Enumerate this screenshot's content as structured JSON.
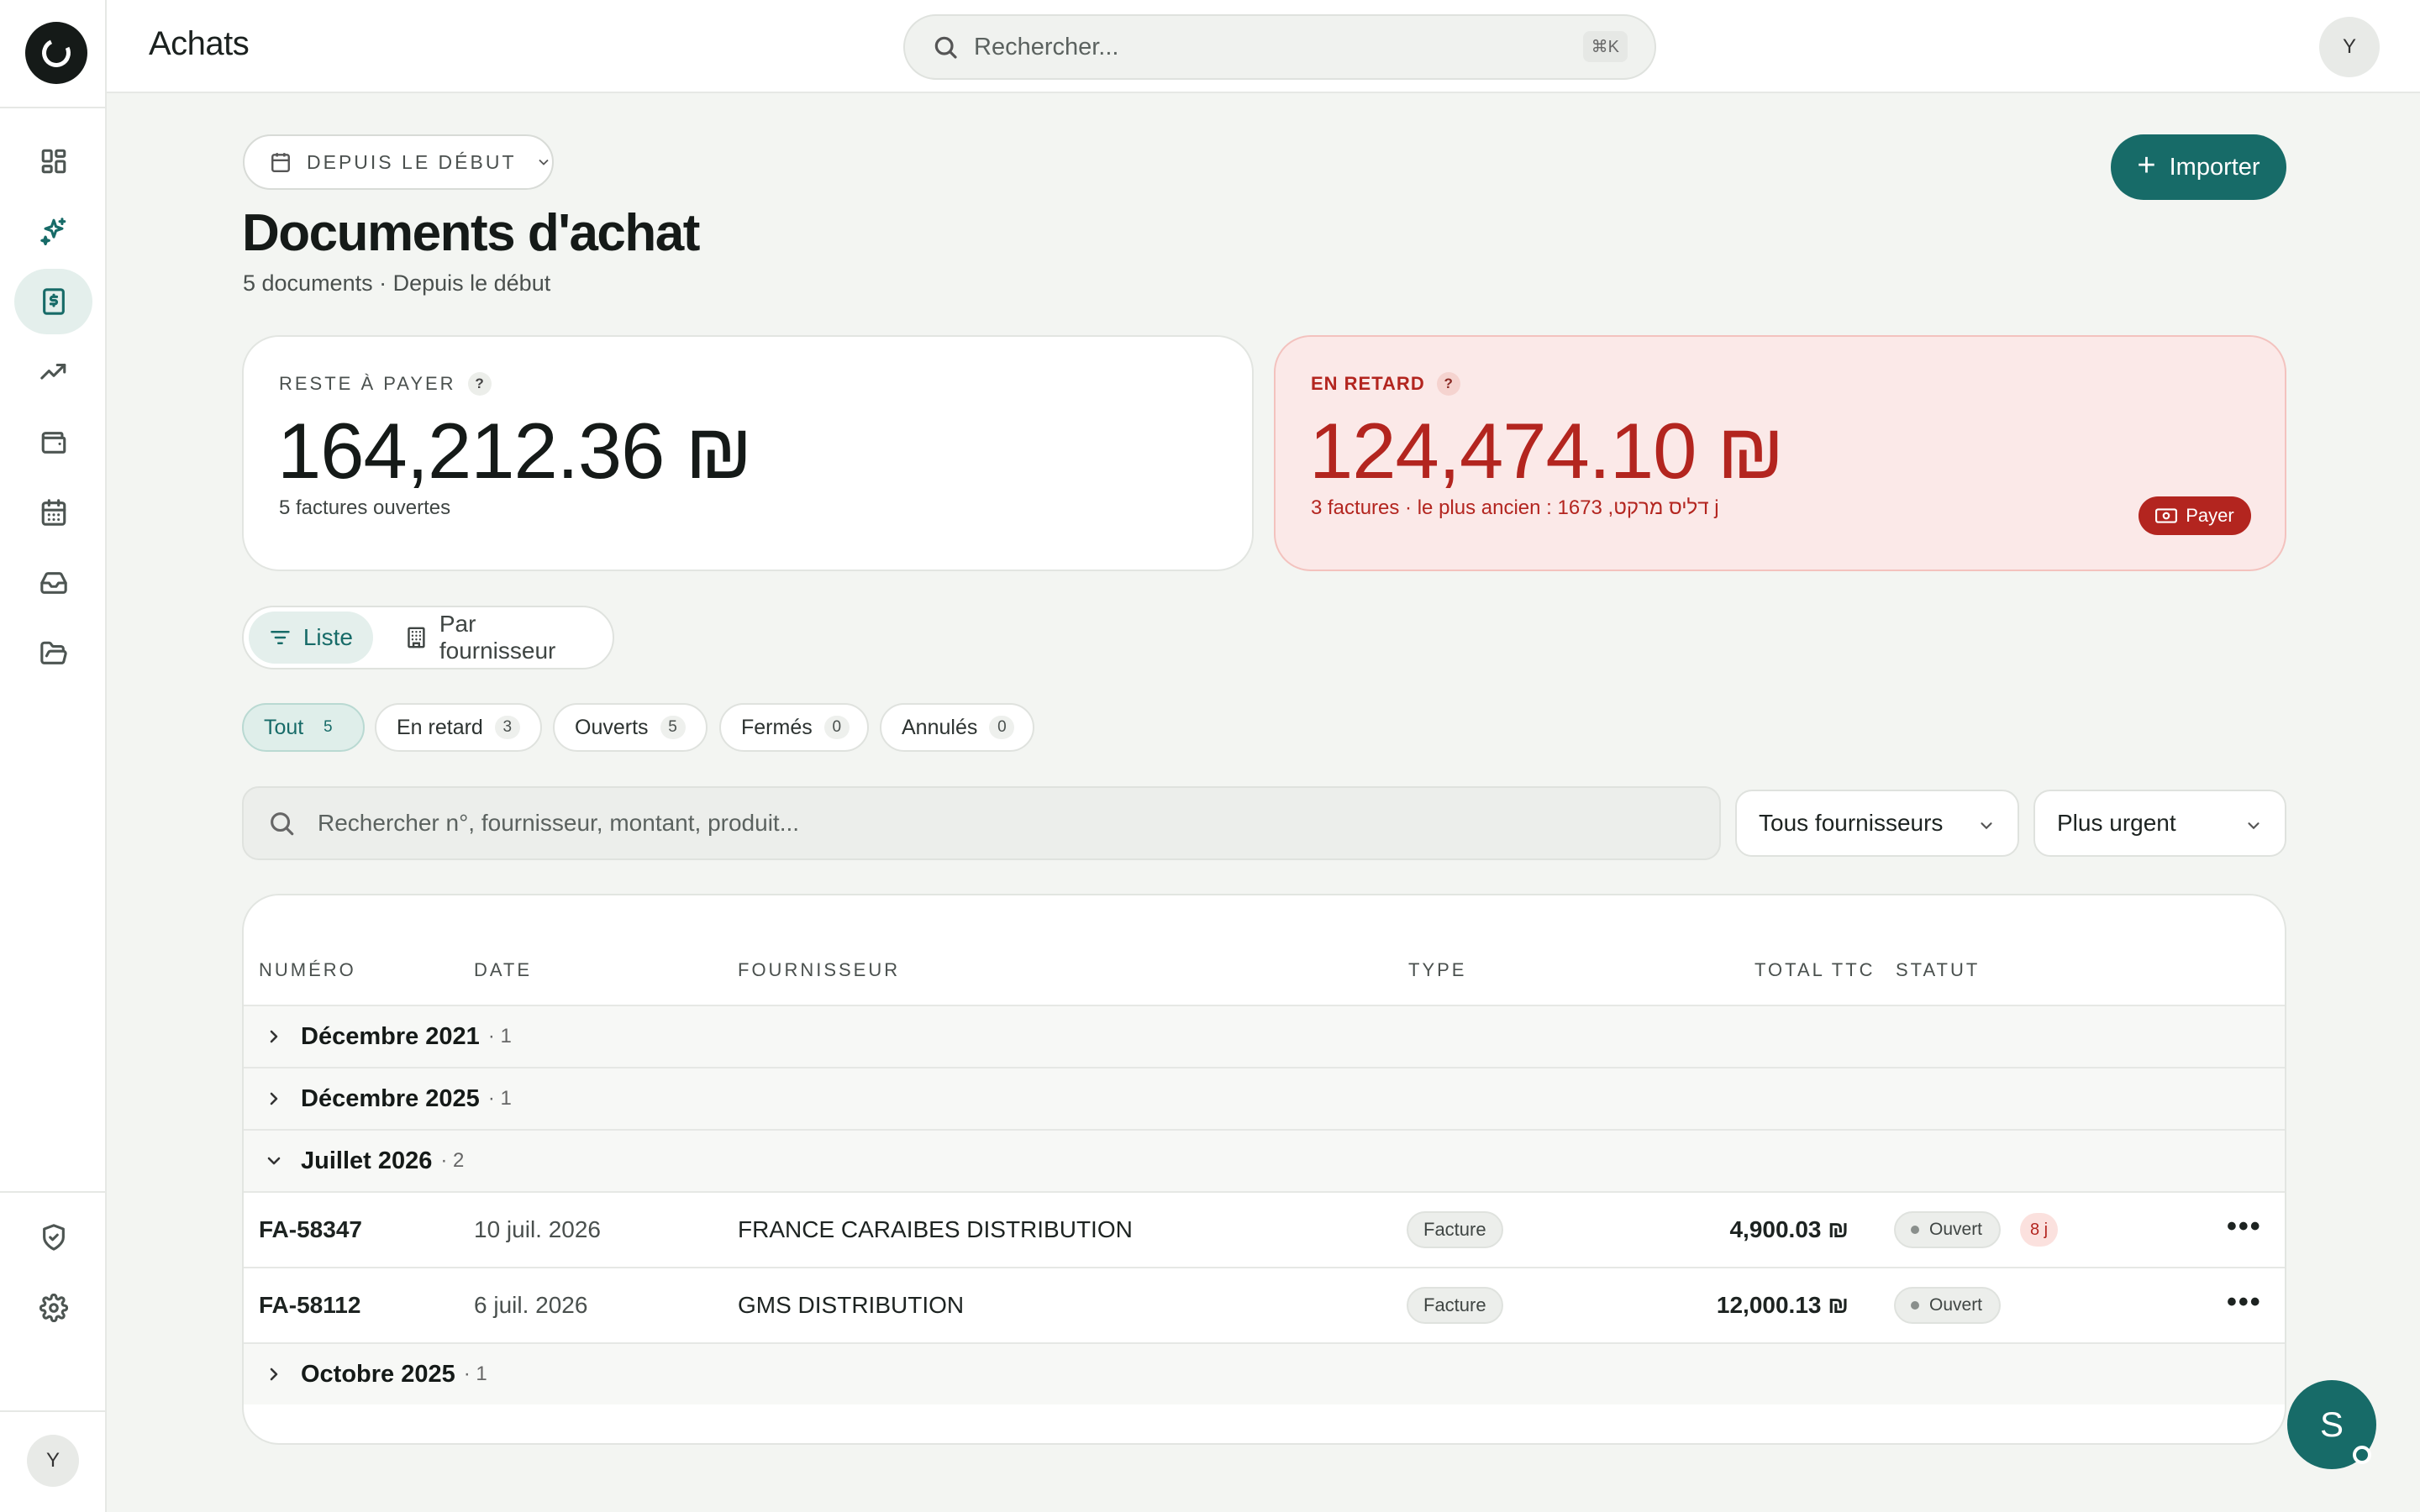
{
  "app": {
    "title": "Achats",
    "avatar_initial": "Y",
    "side_avatar_initial": "Y"
  },
  "search": {
    "placeholder": "Rechercher...",
    "shortcut": "⌘K"
  },
  "sidebar": {
    "items": [
      {
        "name": "dashboard",
        "icon": "grid-icon"
      },
      {
        "name": "ai",
        "icon": "sparkles-icon"
      },
      {
        "name": "purchases",
        "icon": "receipt-icon",
        "active": true
      },
      {
        "name": "trends",
        "icon": "trending-up-icon"
      },
      {
        "name": "wallet",
        "icon": "wallet-icon"
      },
      {
        "name": "calendar",
        "icon": "calendar-icon"
      },
      {
        "name": "inbox",
        "icon": "inbox-icon"
      },
      {
        "name": "folder",
        "icon": "folder-icon"
      }
    ],
    "bottom_items": [
      {
        "name": "security",
        "icon": "shield-check-icon"
      },
      {
        "name": "settings",
        "icon": "gear-icon"
      }
    ]
  },
  "period_filter": {
    "label": "DEPUIS LE DÉBUT"
  },
  "import_button": {
    "label": "Importer"
  },
  "page": {
    "title": "Documents d'achat",
    "subtitle": "5 documents · Depuis le début"
  },
  "cards": {
    "remaining": {
      "label": "RESTE À PAYER",
      "amount": "164,212.36 ₪",
      "sub": "5 factures ouvertes"
    },
    "overdue": {
      "label": "EN RETARD",
      "amount": "124,474.10 ₪",
      "sub": "3 factures · le plus ancien : דליס מרקט, 1673 j",
      "pay_label": "Payer"
    }
  },
  "view_toggle": {
    "list": "Liste",
    "by_supplier": "Par fournisseur"
  },
  "filters": [
    {
      "label": "Tout",
      "count": "5",
      "active": true
    },
    {
      "label": "En retard",
      "count": "3"
    },
    {
      "label": "Ouverts",
      "count": "5"
    },
    {
      "label": "Fermés",
      "count": "0"
    },
    {
      "label": "Annulés",
      "count": "0"
    }
  ],
  "table_search": {
    "placeholder": "Rechercher n°, fournisseur, montant, produit..."
  },
  "supplier_select": {
    "value": "Tous fournisseurs"
  },
  "sort_select": {
    "value": "Plus urgent"
  },
  "table": {
    "headers": {
      "number": "NUMÉRO",
      "date": "DATE",
      "supplier": "FOURNISSEUR",
      "type": "TYPE",
      "total": "TOTAL TTC",
      "status": "STATUT"
    },
    "groups": [
      {
        "label": "Décembre 2021",
        "count": "· 1",
        "expanded": false
      },
      {
        "label": "Décembre 2025",
        "count": "· 1",
        "expanded": false
      },
      {
        "label": "Juillet 2026",
        "count": "· 2",
        "expanded": true
      },
      {
        "label": "Octobre 2025",
        "count": "· 1",
        "expanded": false
      }
    ],
    "rows": [
      {
        "number": "FA-58347",
        "date": "10 juil. 2026",
        "supplier": "FRANCE CARAIBES DISTRIBUTION",
        "type": "Facture",
        "total": "4,900.03 ₪",
        "status": "Ouvert",
        "late": "8 j"
      },
      {
        "number": "FA-58112",
        "date": "6 juil. 2026",
        "supplier": "GMS DISTRIBUTION",
        "type": "Facture",
        "total": "12,000.13 ₪",
        "status": "Ouvert"
      }
    ]
  },
  "fab": {
    "initial": "S"
  },
  "colors": {
    "accent": "#176b68",
    "danger": "#b3251f",
    "background": "#f3f5f2"
  }
}
